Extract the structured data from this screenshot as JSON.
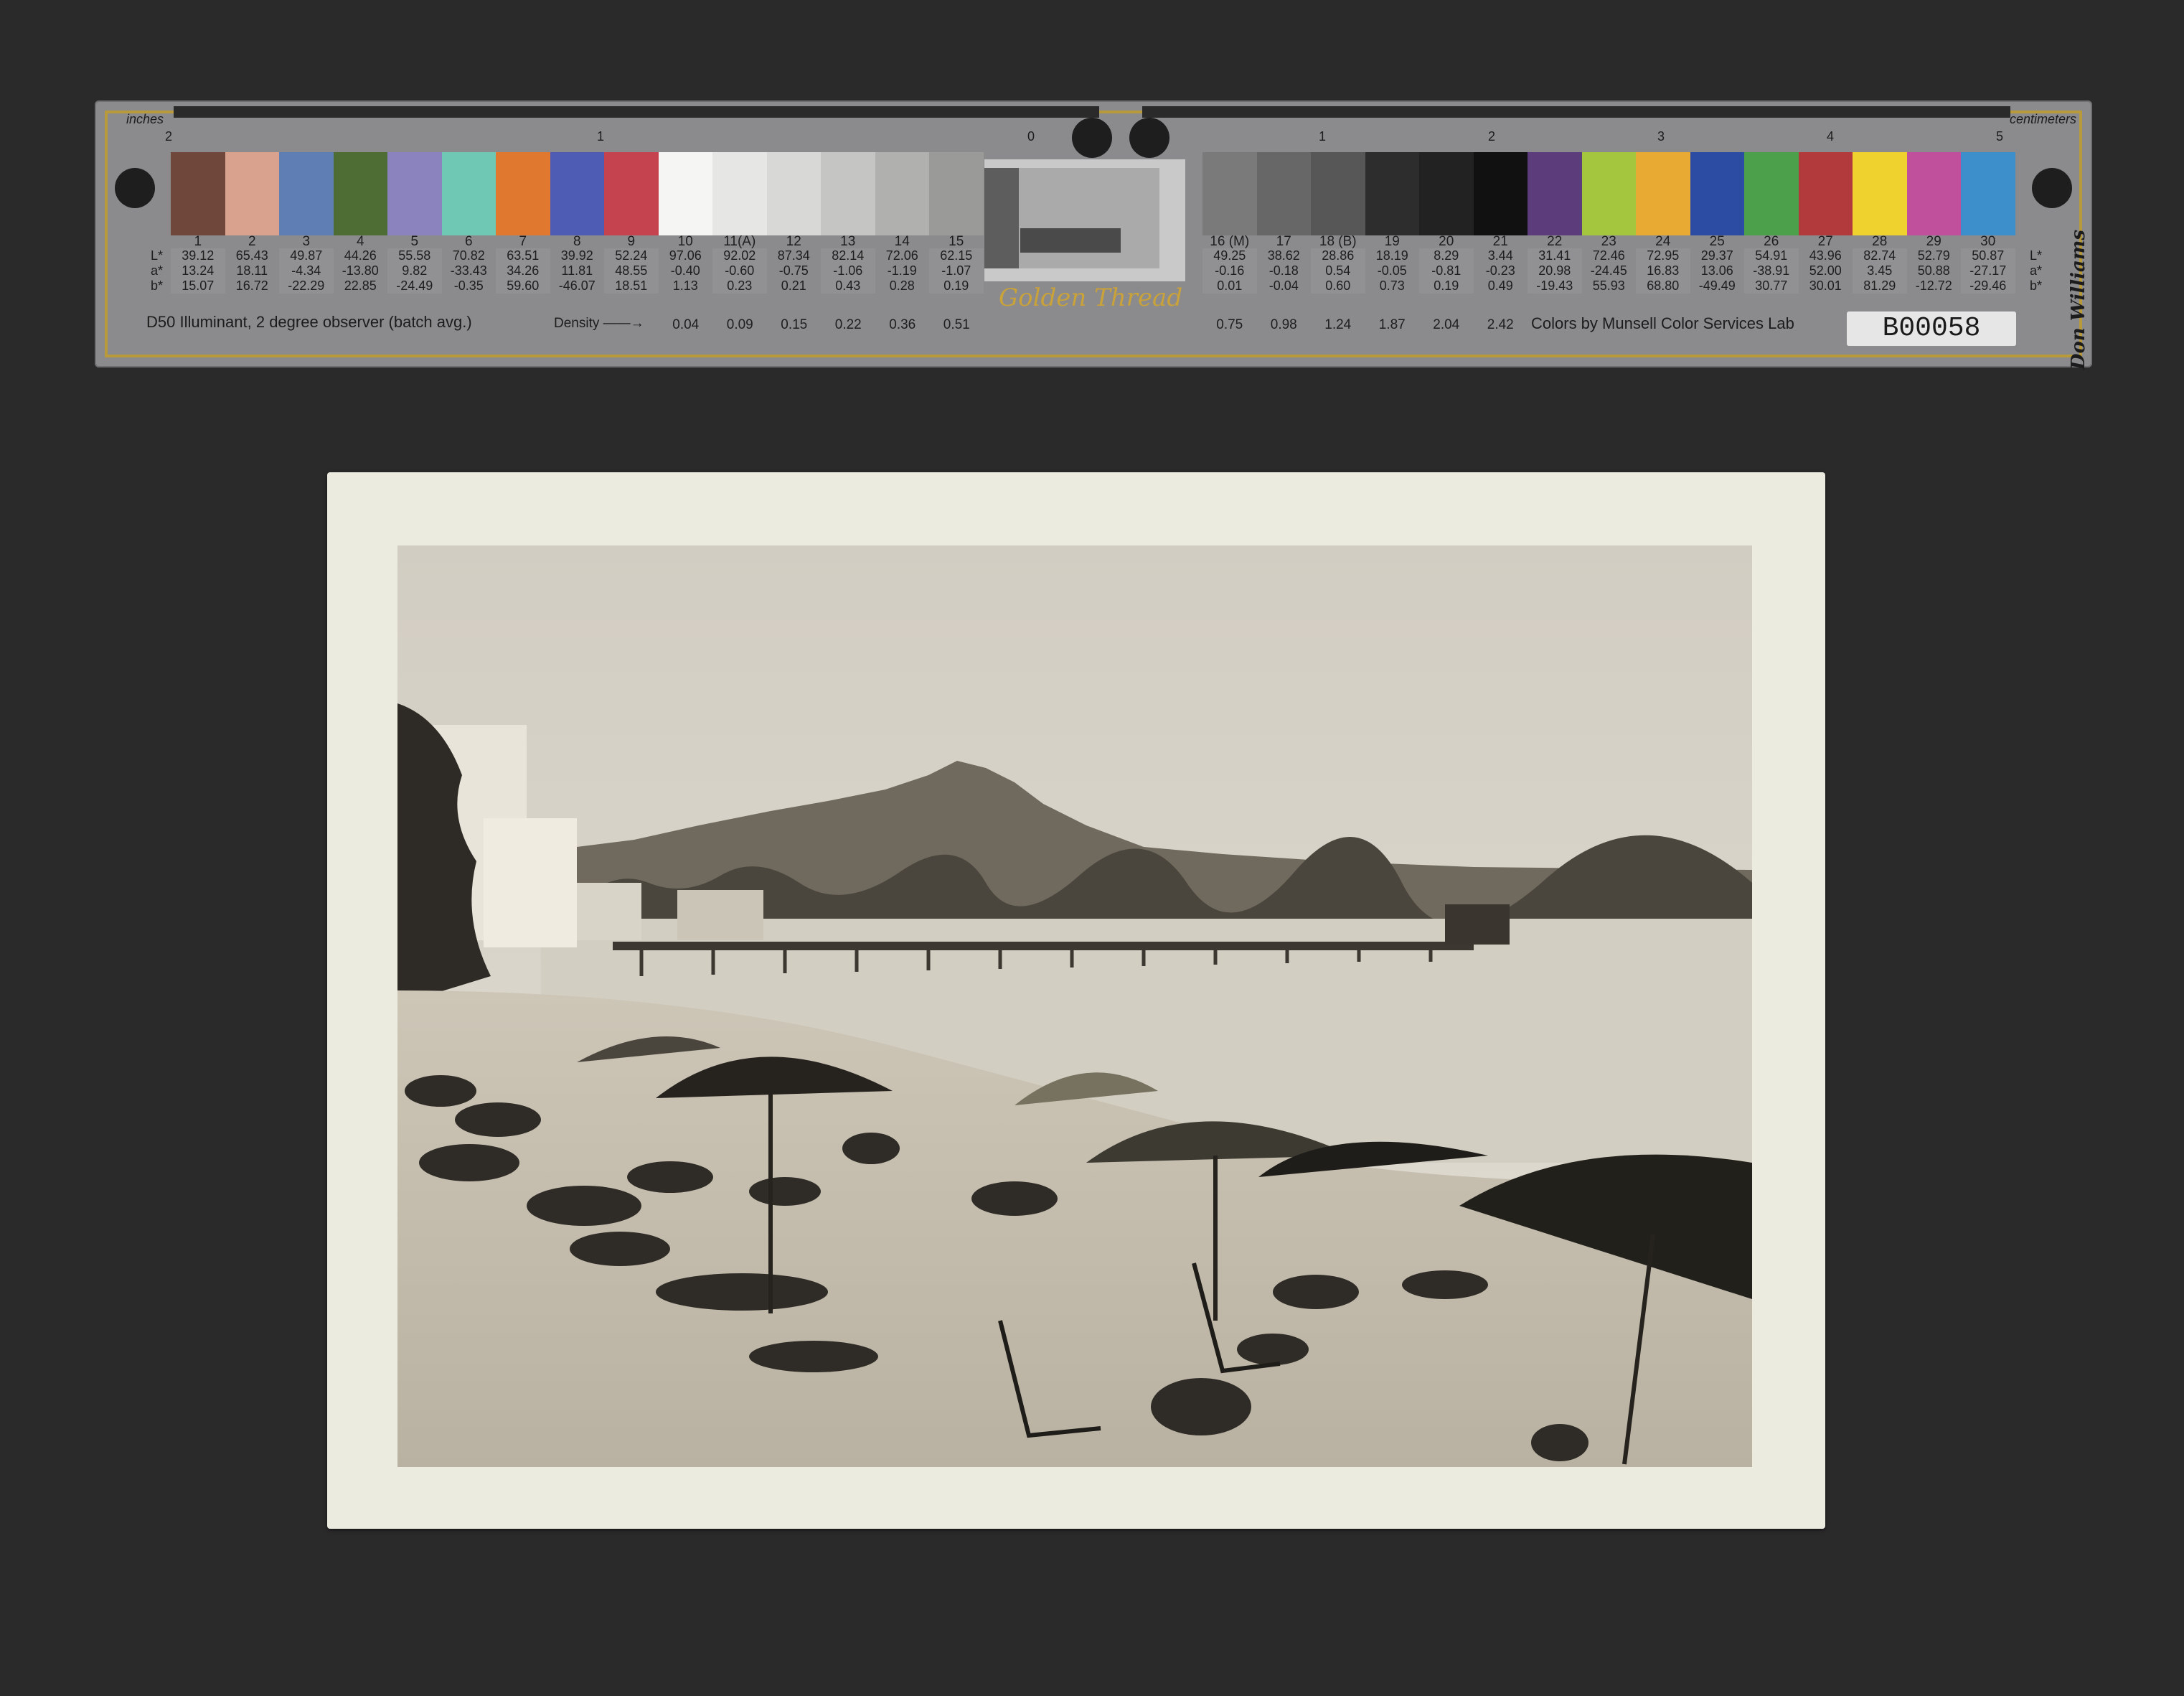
{
  "color_target": {
    "unit_left": "inches",
    "unit_right": "centimeters",
    "inch_ticks": [
      "2",
      "1",
      "0"
    ],
    "cm_ticks": [
      "0",
      "1",
      "2",
      "3",
      "4",
      "5"
    ],
    "patch_numbers_left": [
      "1",
      "2",
      "3",
      "4",
      "5",
      "6",
      "7",
      "8",
      "9",
      "10",
      "11(A)",
      "12",
      "13",
      "14",
      "15"
    ],
    "patch_numbers_right": [
      "16 (M)",
      "17",
      "18 (B)",
      "19",
      "20",
      "21",
      "22",
      "23",
      "24",
      "25",
      "26",
      "27",
      "28",
      "29",
      "30"
    ],
    "patch_colors_left": [
      "#70483b",
      "#d8a28f",
      "#5f7fb4",
      "#4d6d35",
      "#8a83bd",
      "#6ec8b3",
      "#e07830",
      "#4e5cb3",
      "#c4434f",
      "#f5f5f3",
      "#e6e6e4",
      "#d8d8d6",
      "#c5c5c3",
      "#b0b0ae",
      "#9a9a98"
    ],
    "patch_colors_right": [
      "#7a7a7a",
      "#676767",
      "#575757",
      "#2d2d2d",
      "#222222",
      "#111111",
      "#5d3c7c",
      "#a4c63f",
      "#e9aa34",
      "#2c4ba3",
      "#4da04b",
      "#b33a3c",
      "#f0d22e",
      "#c0509b",
      "#3c8fcb"
    ],
    "lab_labels": [
      "L*",
      "a*",
      "b*"
    ],
    "lab_left": [
      [
        "39.12",
        "13.24",
        "15.07"
      ],
      [
        "65.43",
        "18.11",
        "16.72"
      ],
      [
        "49.87",
        "-4.34",
        "-22.29"
      ],
      [
        "44.26",
        "-13.80",
        "22.85"
      ],
      [
        "55.58",
        "9.82",
        "-24.49"
      ],
      [
        "70.82",
        "-33.43",
        "-0.35"
      ],
      [
        "63.51",
        "34.26",
        "59.60"
      ],
      [
        "39.92",
        "11.81",
        "-46.07"
      ],
      [
        "52.24",
        "48.55",
        "18.51"
      ],
      [
        "97.06",
        "-0.40",
        "1.13"
      ],
      [
        "92.02",
        "-0.60",
        "0.23"
      ],
      [
        "87.34",
        "-0.75",
        "0.21"
      ],
      [
        "82.14",
        "-1.06",
        "0.43"
      ],
      [
        "72.06",
        "-1.19",
        "0.28"
      ],
      [
        "62.15",
        "-1.07",
        "0.19"
      ]
    ],
    "lab_right": [
      [
        "49.25",
        "-0.16",
        "0.01"
      ],
      [
        "38.62",
        "-0.18",
        "-0.04"
      ],
      [
        "28.86",
        "0.54",
        "0.60"
      ],
      [
        "18.19",
        "-0.05",
        "0.73"
      ],
      [
        "8.29",
        "-0.81",
        "0.19"
      ],
      [
        "3.44",
        "-0.23",
        "0.49"
      ],
      [
        "31.41",
        "20.98",
        "-19.43"
      ],
      [
        "72.46",
        "-24.45",
        "55.93"
      ],
      [
        "72.95",
        "16.83",
        "68.80"
      ],
      [
        "29.37",
        "13.06",
        "-49.49"
      ],
      [
        "54.91",
        "-38.91",
        "30.77"
      ],
      [
        "43.96",
        "52.00",
        "30.01"
      ],
      [
        "82.74",
        "3.45",
        "81.29"
      ],
      [
        "52.79",
        "50.88",
        "-12.72"
      ],
      [
        "50.87",
        "-27.17",
        "-29.46"
      ]
    ],
    "illuminant_note": "D50 Illuminant, 2 degree observer (batch avg.)",
    "density_label": "Density",
    "density_left": [
      "0.04",
      "0.09",
      "0.15",
      "0.22",
      "0.36",
      "0.51"
    ],
    "density_right": [
      "0.75",
      "0.98",
      "1.24",
      "1.87",
      "2.04",
      "2.42"
    ],
    "credit": "Colors by Munsell Color Services Lab",
    "brand": "Golden Thread",
    "vendor": "Don Williams",
    "card_id": "B00058"
  },
  "photograph": {
    "tone": "sepia",
    "colors": {
      "sky": "#d8d4c9",
      "mountain": "#6f6a5d",
      "water": "#cfcabd",
      "sand": "#c7c0b1",
      "mount": "#ecebe0"
    }
  }
}
